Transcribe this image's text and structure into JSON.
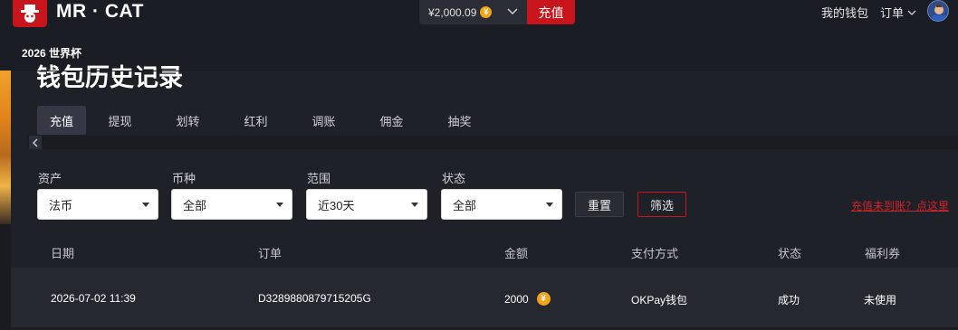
{
  "header": {
    "brand": "MR · CAT",
    "balance": "¥2,000.09",
    "deposit_label": "充值",
    "wallet_link": "我的钱包",
    "orders_label": "订单",
    "subnav": "2026 世界杯"
  },
  "page": {
    "title": "钱包历史记录"
  },
  "tabs": [
    {
      "label": "充值",
      "active": true
    },
    {
      "label": "提现"
    },
    {
      "label": "划转"
    },
    {
      "label": "红利"
    },
    {
      "label": "调账"
    },
    {
      "label": "佣金"
    },
    {
      "label": "抽奖"
    }
  ],
  "filters": {
    "asset": {
      "label": "资产",
      "value": "法币"
    },
    "currency": {
      "label": "币种",
      "value": "全部"
    },
    "range": {
      "label": "范围",
      "value": "近30天"
    },
    "status": {
      "label": "状态",
      "value": "全部"
    },
    "reset_label": "重置",
    "filter_label": "筛选",
    "not_arrived_link": "充值未到账？点这里"
  },
  "table": {
    "columns": [
      "日期",
      "订单",
      "金额",
      "支付方式",
      "状态",
      "福利券"
    ],
    "rows": [
      {
        "date": "2026-07-02 11:39",
        "order": "D3289880879715205G",
        "amount": "2000",
        "payment": "OKPay钱包",
        "status": "成功",
        "coupon": "未使用"
      }
    ]
  },
  "colors": {
    "accent": "#c8151b",
    "coin": "#f2a51a",
    "background": "#1f2128"
  }
}
